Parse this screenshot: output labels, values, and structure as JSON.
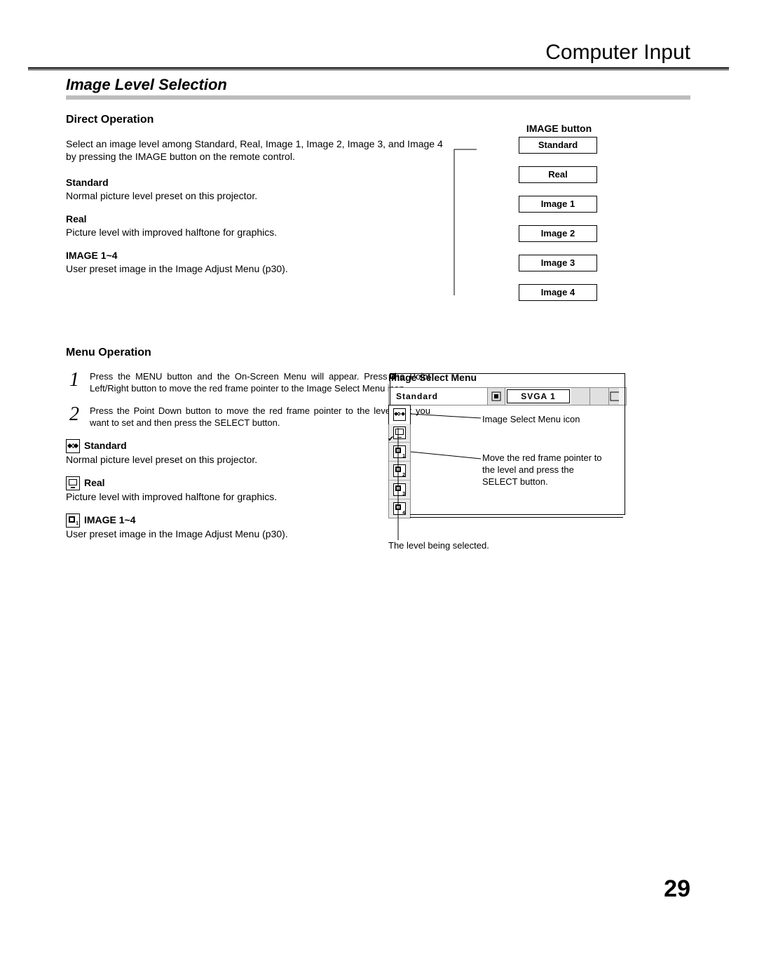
{
  "header": {
    "title": "Computer Input"
  },
  "section_title": "Image Level Selection",
  "direct": {
    "heading": "Direct Operation",
    "intro": "Select an image level among Standard, Real, Image 1, Image 2, Image 3, and Image 4 by pressing the IMAGE button on the remote control.",
    "items": [
      {
        "name": "Standard",
        "desc": "Normal picture level preset on this projector."
      },
      {
        "name": "Real",
        "desc": "Picture level with improved halftone for graphics."
      },
      {
        "name": "IMAGE 1~4",
        "desc": "User preset image in the Image Adjust Menu (p30)."
      }
    ]
  },
  "flow": {
    "title": "IMAGE button",
    "steps": [
      "Standard",
      "Real",
      "Image 1",
      "Image 2",
      "Image 3",
      "Image 4"
    ]
  },
  "menu": {
    "heading": "Menu Operation",
    "steps": [
      {
        "n": "1",
        "text": "Press the MENU button and the On-Screen Menu will appear. Press the Point Left/Right button to move the red frame pointer to the Image Select Menu icon."
      },
      {
        "n": "2",
        "text": "Press the Point Down button to move the red frame pointer to the level that you want to set and then press the SELECT button."
      }
    ],
    "options": [
      {
        "key": "standard",
        "label": "Standard",
        "desc": "Normal picture level preset on this projector."
      },
      {
        "key": "real",
        "label": "Real",
        "desc": "Picture level with improved halftone for graphics."
      },
      {
        "key": "image14",
        "label": "IMAGE 1~4",
        "desc": "User preset image in the Image Adjust Menu (p30)."
      }
    ]
  },
  "select_menu": {
    "title": "Image Select Menu",
    "current": "Standard",
    "mode": "SVGA 1",
    "side_numbers": [
      "1",
      "2",
      "3",
      "4"
    ],
    "callouts": {
      "icon": "Image Select Menu icon",
      "pointer": "Move the red frame pointer to the level and press the SELECT button.",
      "selected": "The level being selected."
    }
  },
  "page_number": "29"
}
